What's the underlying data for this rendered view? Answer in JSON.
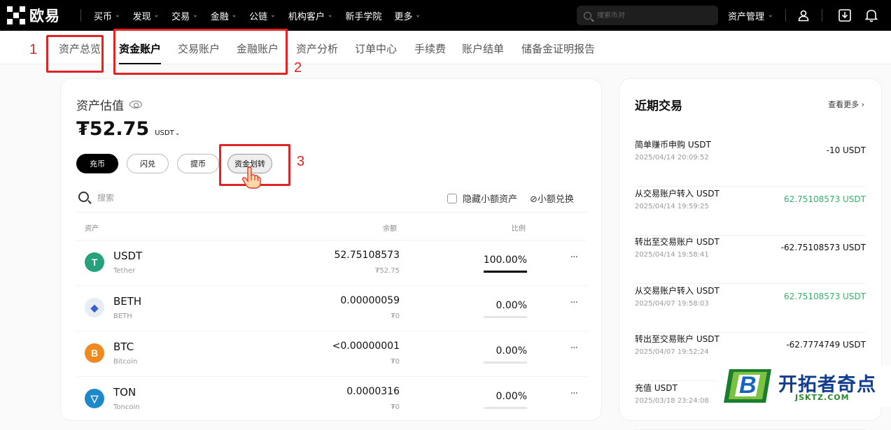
{
  "topbar": {
    "brand": "欧易",
    "nav": [
      {
        "label": "买币",
        "dropdown": true
      },
      {
        "label": "发现",
        "dropdown": true
      },
      {
        "label": "交易",
        "dropdown": true
      },
      {
        "label": "金融",
        "dropdown": true
      },
      {
        "label": "公链",
        "dropdown": true
      },
      {
        "label": "机构客户",
        "dropdown": true
      },
      {
        "label": "新手学院",
        "dropdown": false
      },
      {
        "label": "更多",
        "dropdown": true
      }
    ],
    "search_placeholder": "搜索币对",
    "asset_management": "资产管理",
    "icons": [
      "user-icon",
      "download-icon",
      "bell-icon"
    ]
  },
  "subnav": {
    "tabs": [
      {
        "label": "资产总览",
        "active": false
      },
      {
        "label": "资金账户",
        "active": true
      },
      {
        "label": "交易账户",
        "active": false
      },
      {
        "label": "金融账户",
        "active": false
      },
      {
        "label": "资产分析",
        "active": false
      },
      {
        "label": "订单中心",
        "active": false
      },
      {
        "label": "手续费",
        "active": false
      },
      {
        "label": "账户结单",
        "active": false
      },
      {
        "label": "储备金证明报告",
        "active": false
      }
    ]
  },
  "annotations": [
    "1",
    "2",
    "3"
  ],
  "valuation": {
    "label": "资产估值",
    "amount": "₮52.75",
    "unit": "USDT"
  },
  "actions": [
    "充币",
    "闪兑",
    "提币",
    "资金划转"
  ],
  "table_tools": {
    "search_placeholder": "搜索",
    "hide_small": "隐藏小额资产",
    "small_swap": "小额兑换"
  },
  "table": {
    "headers": {
      "asset": "资产",
      "balance": "余额",
      "ratio": "比例"
    },
    "rows": [
      {
        "symbol": "USDT",
        "name": "Tether",
        "balance": "52.75108573",
        "fiat": "₮52.75",
        "ratio": "100.00%",
        "ratio_value": 1.0,
        "color": "#26a17b",
        "glyph": "T"
      },
      {
        "symbol": "BETH",
        "name": "BETH",
        "balance": "0.00000059",
        "fiat": "₮0",
        "ratio": "0.00%",
        "ratio_value": 0.0,
        "color": "#e8ecf5",
        "glyph": "◆"
      },
      {
        "symbol": "BTC",
        "name": "Bitcoin",
        "balance": "<0.00000001",
        "fiat": "₮0",
        "ratio": "0.00%",
        "ratio_value": 0.0,
        "color": "#f0891f",
        "glyph": "B"
      },
      {
        "symbol": "TON",
        "name": "Toncoin",
        "balance": "0.0000316",
        "fiat": "₮0",
        "ratio": "0.00%",
        "ratio_value": 0.0,
        "color": "#1e88c8",
        "glyph": "▽"
      }
    ],
    "more": "···"
  },
  "recent": {
    "title": "近期交易",
    "more": "查看更多",
    "items": [
      {
        "name": "简单赚币申购 USDT",
        "time": "2025/04/14 20:09:52",
        "amount": "-10 USDT",
        "positive": false
      },
      {
        "name": "从交易账户转入 USDT",
        "time": "2025/04/14 19:59:25",
        "amount": "62.75108573 USDT",
        "positive": true
      },
      {
        "name": "转出至交易账户 USDT",
        "time": "2025/04/14 19:58:41",
        "amount": "-62.75108573 USDT",
        "positive": false
      },
      {
        "name": "从交易账户转入 USDT",
        "time": "2025/04/07 19:58:03",
        "amount": "62.75108573 USDT",
        "positive": true
      },
      {
        "name": "转出至交易账户 USDT",
        "time": "2025/04/07 19:52:24",
        "amount": "-62.7774749 USDT",
        "positive": false
      },
      {
        "name": "充值 USDT",
        "time": "2025/03/18 23:24:08",
        "amount": "",
        "positive": false
      }
    ]
  },
  "watermark": {
    "text": "开拓者奇点",
    "url": "JSKTZ.COM",
    "logo_letter": "B"
  }
}
